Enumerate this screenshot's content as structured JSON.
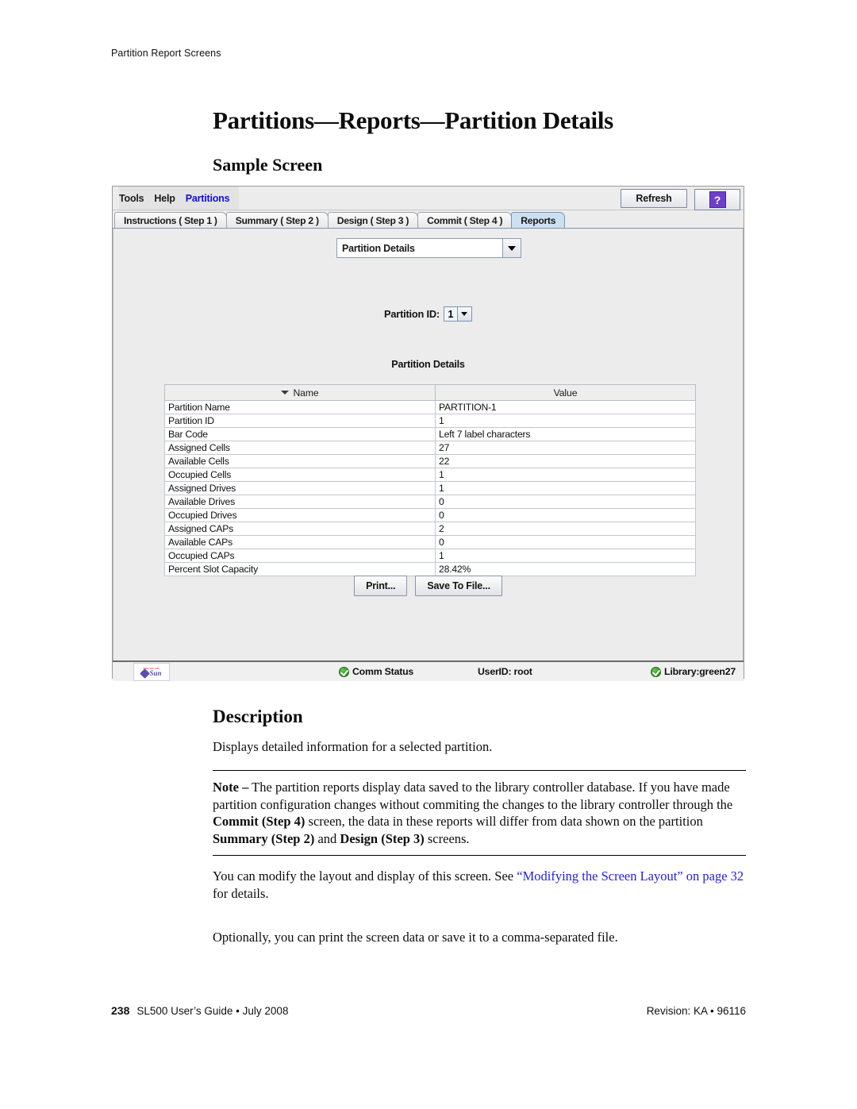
{
  "page": {
    "running_head": "Partition Report Screens",
    "title": "Partitions—Reports—Partition Details",
    "sample_screen_heading": "Sample Screen",
    "description_heading": "Description"
  },
  "app": {
    "menu": {
      "tools": "Tools",
      "help": "Help",
      "partitions": "Partitions",
      "partitions_color": "#1111dd"
    },
    "toolbar": {
      "refresh_label": "Refresh",
      "help_glyph": "?",
      "help_bg": "#6e3fc9"
    },
    "tabs": [
      {
        "label": "Instructions ( Step 1 )",
        "selected": false
      },
      {
        "label": "Summary ( Step 2 )",
        "selected": false
      },
      {
        "label": "Design ( Step 3 )",
        "selected": false
      },
      {
        "label": "Commit ( Step 4 )",
        "selected": false
      },
      {
        "label": "Reports",
        "selected": true
      }
    ],
    "report_combo": {
      "value": "Partition Details",
      "icon": "chevron-down-icon"
    },
    "partition_id": {
      "label": "Partition ID:",
      "value": "1",
      "icon": "chevron-down-icon"
    },
    "table": {
      "caption": "Partition Details",
      "sort_indicator": "sort-descending-icon",
      "columns": [
        "Name",
        "Value"
      ],
      "rows": [
        {
          "name": "Partition Name",
          "value": "PARTITION-1"
        },
        {
          "name": "Partition ID",
          "value": "1"
        },
        {
          "name": "Bar Code",
          "value": "Left 7 label characters"
        },
        {
          "name": "Assigned Cells",
          "value": "27"
        },
        {
          "name": "Available Cells",
          "value": "22"
        },
        {
          "name": "Occupied Cells",
          "value": "1"
        },
        {
          "name": "Assigned Drives",
          "value": "1"
        },
        {
          "name": "Available Drives",
          "value": "0"
        },
        {
          "name": "Occupied Drives",
          "value": "0"
        },
        {
          "name": "Assigned CAPs",
          "value": "2"
        },
        {
          "name": "Available CAPs",
          "value": "0"
        },
        {
          "name": "Occupied CAPs",
          "value": "1"
        },
        {
          "name": "Percent Slot Capacity",
          "value": "28.42%"
        }
      ]
    },
    "buttons": {
      "print": "Print...",
      "save_to_file": "Save To File..."
    },
    "status_bar": {
      "logo_text": "Sun",
      "logo_top_text": "www.sun.com",
      "comm_status": "Comm Status",
      "user_id": "UserID: root",
      "library": "Library:green27",
      "status_ok_color": "#2f8f1e"
    }
  },
  "body": {
    "description": "Displays detailed information for a selected partition.",
    "note": {
      "label": "Note –",
      "part1": " The partition reports display data saved to the library controller database. If you have made partition configuration changes without commiting the changes to the library controller through the ",
      "bold1": "Commit (Step 4)",
      "part2": " screen, the data in these reports will differ from data shown on the partition ",
      "bold2": "Summary (Step 2)",
      "part3": " and ",
      "bold3": "Design (Step 3)",
      "part4": " screens."
    },
    "layout_para": {
      "part1": "You can modify the layout and display of this screen. See ",
      "link": "“Modifying the Screen Layout” on page 32",
      "link_color": "#2222dd",
      "part2": " for details."
    },
    "optional_para": "Optionally, you can print the screen data or save it to a comma-separated file."
  },
  "footer": {
    "page_number": "238",
    "guide": "SL500 User’s Guide • July 2008",
    "revision": "Revision: KA • 96116"
  }
}
